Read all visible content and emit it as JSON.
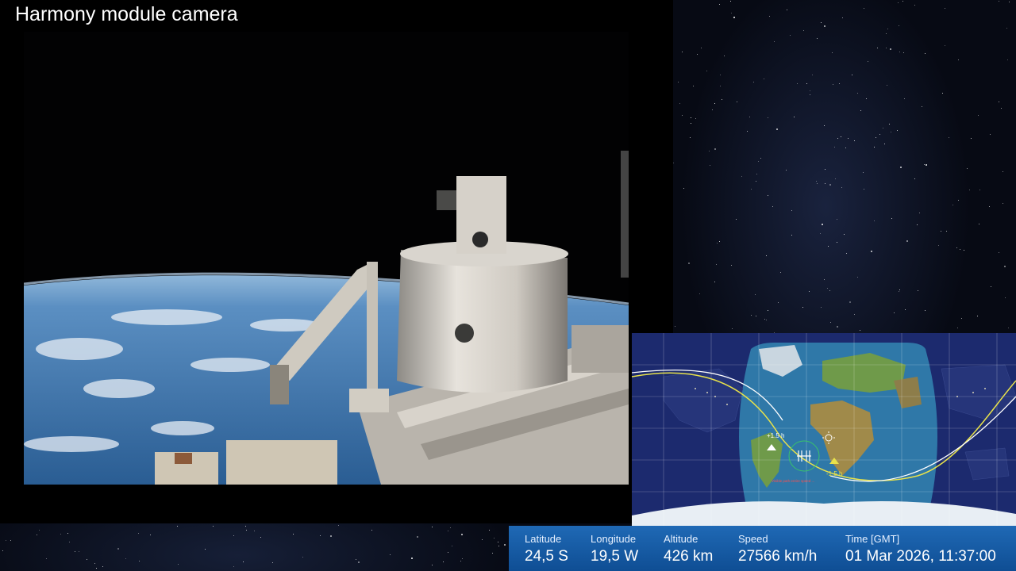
{
  "feed": {
    "title": "Harmony module camera"
  },
  "map": {
    "markers": {
      "orbit_ahead": "+1.5 h",
      "orbit_behind": "-1.5 h",
      "caption": "Visible path entire speed ..."
    },
    "icons": [
      "sun-icon",
      "iss-icon"
    ]
  },
  "telemetry": {
    "latitude": {
      "label": "Latitude",
      "value": "24,5 S"
    },
    "longitude": {
      "label": "Longitude",
      "value": "19,5 W"
    },
    "altitude": {
      "label": "Altitude",
      "value": "426 km"
    },
    "speed": {
      "label": "Speed",
      "value": "27566 km/h"
    },
    "time": {
      "label": "Time [GMT]",
      "value": "01 Mar 2026, 11:37:00"
    }
  },
  "colors": {
    "telemetry_bar": "#1f69b5",
    "orbit_track_yellow": "#e8e24a",
    "orbit_track_white": "#ffffff",
    "night_side": "#1c2a6e",
    "ocean_day": "#2f78a8"
  }
}
